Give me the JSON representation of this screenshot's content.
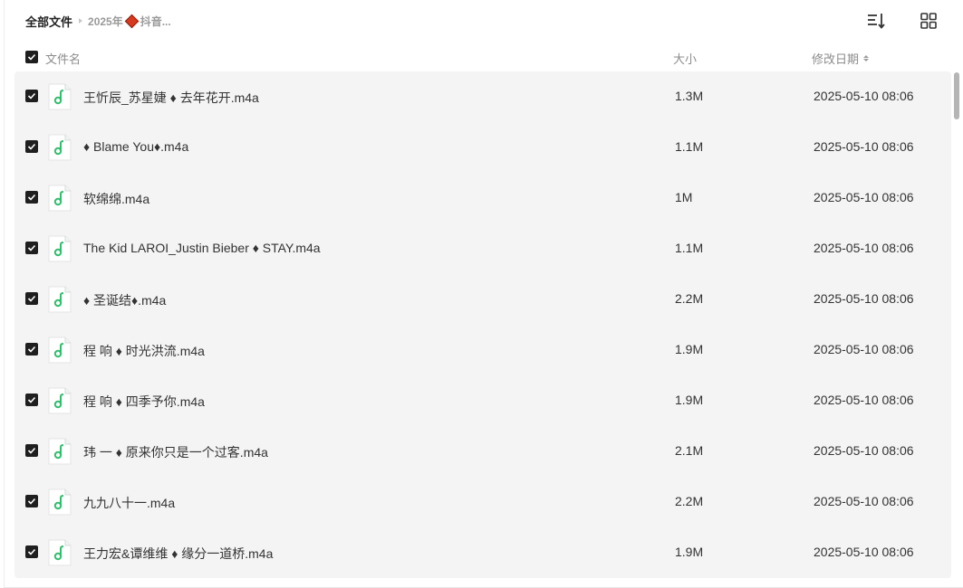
{
  "breadcrumb": {
    "root": "全部文件",
    "current_prefix": "2025年",
    "current_suffix": "抖音..."
  },
  "toolbar": {
    "sort_icon": "sort-list-icon",
    "grid_icon": "grid-view-icon"
  },
  "columns": {
    "name": "文件名",
    "size": "大小",
    "date": "修改日期"
  },
  "files": [
    {
      "name": "王忻辰_苏星婕 ♦ 去年花开.m4a",
      "size": "1.3M",
      "date": "2025-05-10 08:06"
    },
    {
      "name": "♦ Blame You♦.m4a",
      "size": "1.1M",
      "date": "2025-05-10 08:06"
    },
    {
      "name": "软绵绵.m4a",
      "size": "1M",
      "date": "2025-05-10 08:06"
    },
    {
      "name": "The Kid LAROI_Justin Bieber ♦ STAY.m4a",
      "size": "1.1M",
      "date": "2025-05-10 08:06"
    },
    {
      "name": "♦ 圣诞结♦.m4a",
      "size": "2.2M",
      "date": "2025-05-10 08:06"
    },
    {
      "name": "程 响 ♦ 时光洪流.m4a",
      "size": "1.9M",
      "date": "2025-05-10 08:06"
    },
    {
      "name": "程 响 ♦ 四季予你.m4a",
      "size": "1.9M",
      "date": "2025-05-10 08:06"
    },
    {
      "name": "玮 一 ♦ 原来你只是一个过客.m4a",
      "size": "2.1M",
      "date": "2025-05-10 08:06"
    },
    {
      "name": "九九八十一.m4a",
      "size": "2.2M",
      "date": "2025-05-10 08:06"
    },
    {
      "name": "王力宏&谭维维 ♦ 缘分一道桥.m4a",
      "size": "1.9M",
      "date": "2025-05-10 08:06"
    }
  ],
  "colors": {
    "accent_green": "#2fbf6b",
    "checkbox": "#1f1f1f",
    "diamond_red": "#d63a1f"
  }
}
